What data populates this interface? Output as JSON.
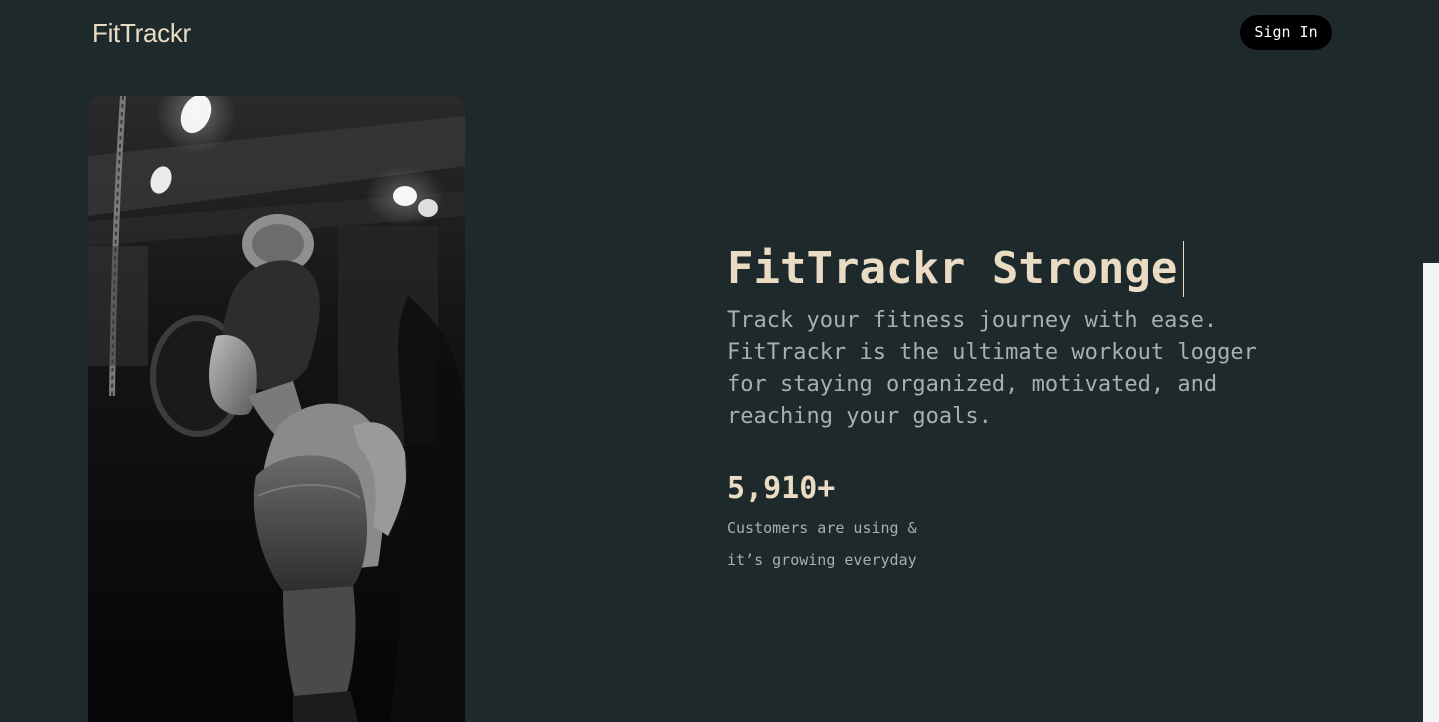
{
  "header": {
    "brand": "FitTrackr",
    "sign_in_label": "Sign In"
  },
  "hero": {
    "image_alt": "woman-lifting-barbell-photo",
    "headline": "FitTrackr Stronge",
    "tagline": "Track your fitness journey with ease. FitTrackr is the ultimate workout logger for staying organized, motivated, and reaching your goals."
  },
  "stats": {
    "value": "5,910+",
    "caption_line1": "Customers are using &",
    "caption_line2": "it’s growing everyday"
  },
  "colors": {
    "background": "#1e292c",
    "accent_text": "#eadcc4",
    "muted_text": "#a7b0b1",
    "button_bg": "#000000"
  }
}
